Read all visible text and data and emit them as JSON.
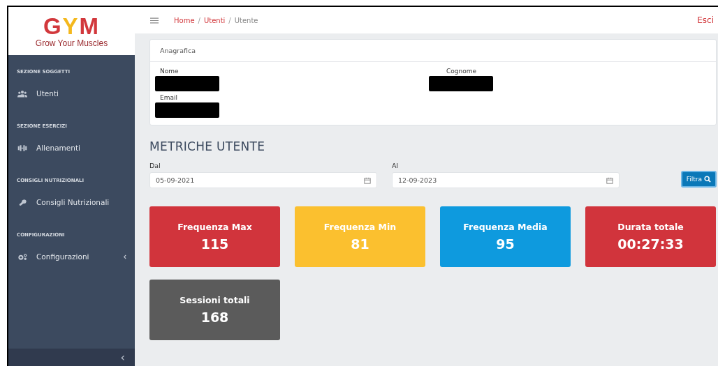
{
  "logo": {
    "title": "GYM",
    "tagline": "Grow Your Muscles"
  },
  "sidebar": {
    "sections": [
      {
        "heading": "SEZIONE SOGGETTI",
        "items": [
          {
            "label": "Utenti",
            "expandable": false
          }
        ]
      },
      {
        "heading": "SEZIONE ESERCIZI",
        "items": [
          {
            "label": "Allenamenti",
            "expandable": false
          }
        ]
      },
      {
        "heading": "CONSIGLI NUTRIZIONALI",
        "items": [
          {
            "label": "Consigli Nutrizionali",
            "expandable": false
          }
        ]
      },
      {
        "heading": "CONFIGURAZIONI",
        "items": [
          {
            "label": "Configurazioni",
            "expandable": true
          }
        ]
      }
    ],
    "collapse": "‹"
  },
  "topbar": {
    "breadcrumb": [
      {
        "label": "Home",
        "link": true
      },
      {
        "label": "Utenti",
        "link": true
      },
      {
        "label": "Utente",
        "link": false
      }
    ],
    "separators": [
      "/",
      "/"
    ],
    "logout": "Esci"
  },
  "profile": {
    "title": "Anagrafica",
    "fields": [
      {
        "label": "Nome"
      },
      {
        "label": "Cognome"
      },
      {
        "label": "Email"
      }
    ]
  },
  "metrics": {
    "title": "METRICHE UTENTE",
    "from": {
      "label": "Dal",
      "value": "05-09-2021"
    },
    "to": {
      "label": "Al",
      "value": "12-09-2023"
    },
    "filter": "Filtra",
    "cards": [
      {
        "label": "Frequenza Max",
        "value": "115",
        "color": "#d1343c"
      },
      {
        "label": "Frequenza Min",
        "value": "81",
        "color": "#fbc02f"
      },
      {
        "label": "Frequenza Media",
        "value": "95",
        "color": "#0e9ade"
      },
      {
        "label": "Durata totale",
        "value": "00:27:33",
        "color": "#d1343c"
      },
      {
        "label": "Sessioni totali",
        "value": "168",
        "color": "#5b5b5b"
      }
    ]
  }
}
